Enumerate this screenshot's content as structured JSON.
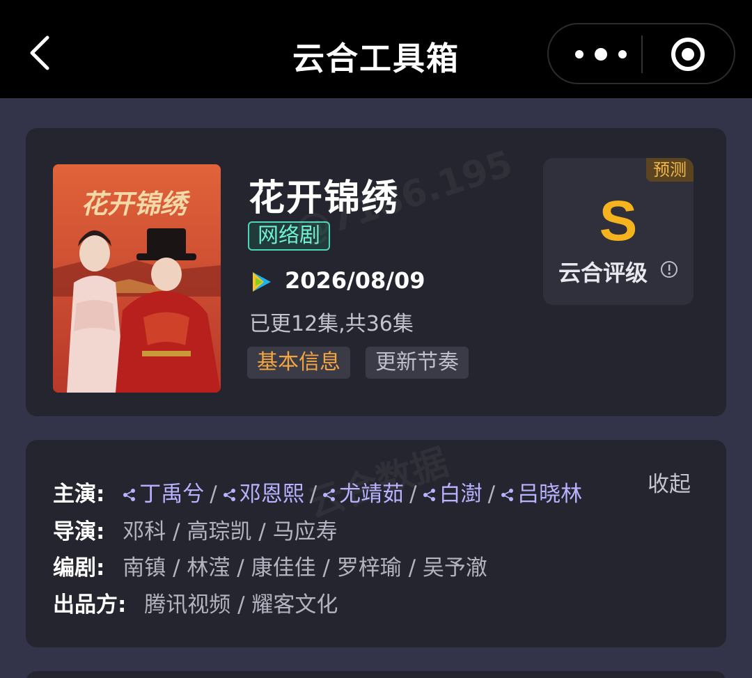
{
  "header": {
    "title": "云合工具箱"
  },
  "show": {
    "title": "花开锦绣",
    "type": "网络剧",
    "platform_icon": "tencent-video-icon",
    "release_date": "2026/08/09",
    "episode_status": "已更12集,共36集",
    "tabs": [
      {
        "label": "基本信息",
        "active": true
      },
      {
        "label": "更新节奏",
        "active": false
      }
    ],
    "poster_title": "花开锦绣"
  },
  "rating": {
    "badge": "预测",
    "grade": "S",
    "label": "云合评级"
  },
  "credits": {
    "collapse_label": "收起",
    "cast_label": "主演:",
    "cast": [
      "丁禹兮",
      "邓恩熙",
      "尤靖茹",
      "白澍",
      "吕晓林"
    ],
    "director_label": "导演:",
    "director": "邓科 / 高琮凯 / 马应寿",
    "writer_label": "编剧:",
    "writer": "南镇 / 林滢 / 康佳佳 / 罗梓瑜 / 吴予澈",
    "producer_label": "出品方:",
    "producer": "腾讯视频 / 耀客文化"
  },
  "colors": {
    "background": "#33334a",
    "card": "#25252f",
    "accent_gold": "#f5b31e",
    "tag_teal": "#4dd6b8",
    "cast_link": "#b9b2ff"
  }
}
